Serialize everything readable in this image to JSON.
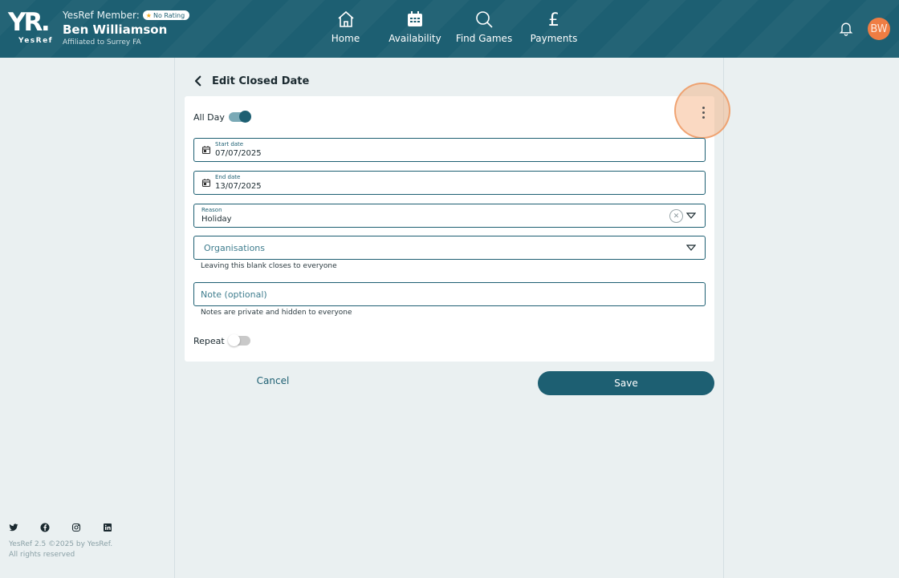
{
  "header": {
    "logo_text": "YR.",
    "logo_sub": "YesRef",
    "member_label": "YesRef Member:",
    "rating_badge": "No Rating",
    "user_name": "Ben Williamson",
    "affiliation": "Affiliated to Surrey FA",
    "nav": {
      "home": "Home",
      "availability": "Availability",
      "find_games": "Find Games",
      "payments": "Payments"
    },
    "avatar_initials": "BW"
  },
  "page": {
    "title": "Edit Closed Date"
  },
  "form": {
    "all_day_label": "All Day",
    "all_day_on": true,
    "start_date_label": "Start date",
    "start_date_value": "07/07/2025",
    "end_date_label": "End date",
    "end_date_value": "13/07/2025",
    "reason_label": "Reason",
    "reason_value": "Holiday",
    "organisations_placeholder": "Organisations",
    "organisations_hint": "Leaving this blank closes to everyone",
    "note_placeholder": "Note (optional)",
    "note_hint": "Notes are private and hidden to everyone",
    "repeat_label": "Repeat",
    "repeat_on": false
  },
  "actions": {
    "cancel": "Cancel",
    "save": "Save"
  },
  "footer": {
    "social_icons": [
      "twitter-icon",
      "facebook-icon",
      "instagram-icon",
      "linkedin-icon"
    ],
    "version_line": "YesRef 2.5 ©2025 by YesRef.",
    "rights_line": "All rights reserved"
  },
  "colors": {
    "brand": "#1d5f72",
    "avatar": "#ef7d43",
    "background": "#eaf0f1"
  }
}
